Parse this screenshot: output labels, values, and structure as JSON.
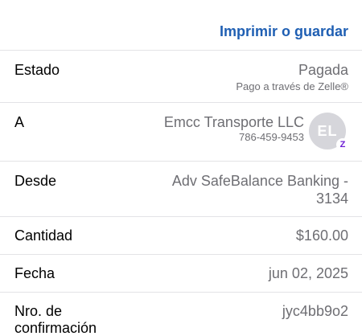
{
  "header": {
    "print_label": "Imprimir o guardar"
  },
  "rows": {
    "estado": {
      "label": "Estado",
      "value": "Pagada",
      "subvalue": "Pago a través de Zelle®"
    },
    "a": {
      "label": "A",
      "name": "Emcc Transporte LLC",
      "phone": "786-459-9453",
      "avatar_initials": "EL",
      "badge_glyph": "Z",
      "badge_icon": "zelle-icon"
    },
    "desde": {
      "label": "Desde",
      "value_line1": "Adv SafeBalance Banking -",
      "value_line2": "3134"
    },
    "cantidad": {
      "label": "Cantidad",
      "value": "$160.00"
    },
    "fecha": {
      "label": "Fecha",
      "value": "jun 02, 2025"
    },
    "confirmacion": {
      "label_line1": "Nro. de",
      "label_line2": "confirmación",
      "value": "jyc4bb9o2"
    }
  },
  "colors": {
    "accent": "#1f5fb3",
    "secondary_text": "#6e6e73",
    "divider": "#e3e3e6",
    "avatar_bg": "#d6d6db",
    "zelle_purple": "#6d1ed4"
  }
}
